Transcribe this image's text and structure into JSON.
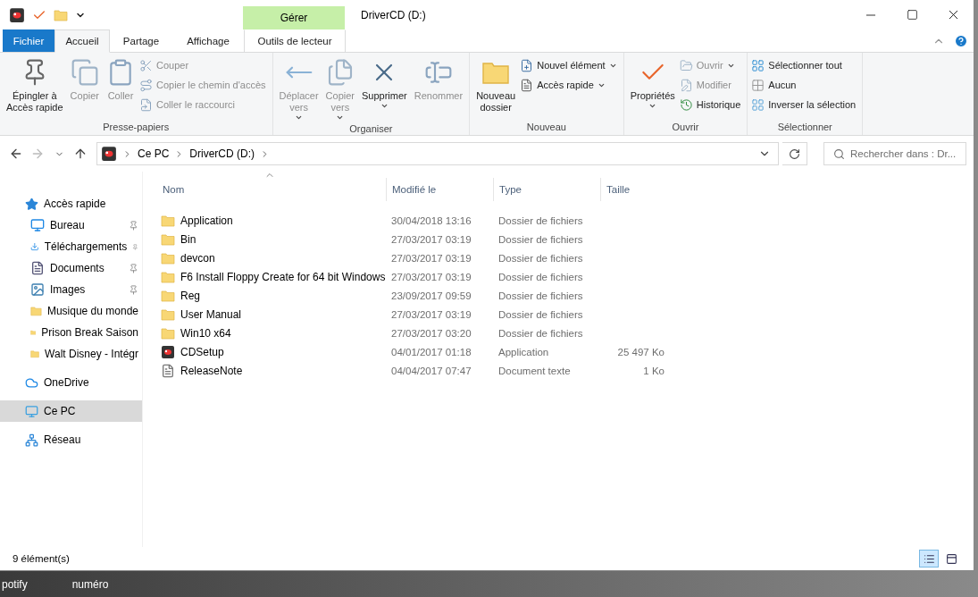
{
  "window": {
    "title": "DriverCD (D:)",
    "context_tab": "Gérer"
  },
  "ribbon_tabs": [
    {
      "label": "Fichier",
      "kind": "file",
      "selected": false
    },
    {
      "label": "Accueil",
      "kind": "tab",
      "selected": true
    },
    {
      "label": "Partage",
      "kind": "tab",
      "selected": false
    },
    {
      "label": "Affichage",
      "kind": "tab",
      "selected": false
    },
    {
      "label": "Outils de lecteur",
      "kind": "context",
      "selected": false
    }
  ],
  "ribbon_groups": [
    {
      "label": "Presse-papiers",
      "items": [
        {
          "label": "Épingler à\nAccès rapide",
          "kind": "large",
          "disabled": false,
          "dropdown": false
        },
        {
          "label": "Copier",
          "kind": "large",
          "disabled": true,
          "dropdown": false
        },
        {
          "label": "Coller",
          "kind": "large",
          "disabled": true,
          "dropdown": false
        },
        {
          "label": "Couper",
          "kind": "small",
          "disabled": true,
          "dropdown": false
        },
        {
          "label": "Copier le chemin d'accès",
          "kind": "small",
          "disabled": true,
          "dropdown": false
        },
        {
          "label": "Coller le raccourci",
          "kind": "small",
          "disabled": true,
          "dropdown": false
        }
      ]
    },
    {
      "label": "Organiser",
      "items": [
        {
          "label": "Déplacer\nvers",
          "kind": "large",
          "disabled": true,
          "dropdown": true
        },
        {
          "label": "Copier\nvers",
          "kind": "large",
          "disabled": true,
          "dropdown": true
        },
        {
          "label": "Supprimer",
          "kind": "large",
          "disabled": false,
          "dropdown": true
        },
        {
          "label": "Renommer",
          "kind": "large",
          "disabled": true,
          "dropdown": false
        }
      ]
    },
    {
      "label": "Nouveau",
      "items": [
        {
          "label": "Nouveau\ndossier",
          "kind": "large",
          "disabled": false,
          "dropdown": false
        },
        {
          "label": "Nouvel élément",
          "kind": "small",
          "disabled": false,
          "dropdown": true
        },
        {
          "label": "Accès rapide",
          "kind": "small",
          "disabled": false,
          "dropdown": true
        }
      ]
    },
    {
      "label": "Ouvrir",
      "items": [
        {
          "label": "Propriétés",
          "kind": "large",
          "disabled": false,
          "dropdown": true
        },
        {
          "label": "Ouvrir",
          "kind": "small",
          "disabled": true,
          "dropdown": true
        },
        {
          "label": "Modifier",
          "kind": "small",
          "disabled": true,
          "dropdown": false
        },
        {
          "label": "Historique",
          "kind": "small",
          "disabled": false,
          "dropdown": false
        }
      ]
    },
    {
      "label": "Sélectionner",
      "items": [
        {
          "label": "Sélectionner tout",
          "kind": "small",
          "disabled": false,
          "dropdown": false
        },
        {
          "label": "Aucun",
          "kind": "small",
          "disabled": false,
          "dropdown": false
        },
        {
          "label": "Inverser la sélection",
          "kind": "small",
          "disabled": false,
          "dropdown": false
        }
      ]
    }
  ],
  "address_bar": {
    "path": [
      "Ce PC",
      "DriverCD (D:)"
    ]
  },
  "search": {
    "placeholder": "Rechercher dans : Dr..."
  },
  "sidebar": {
    "items": [
      {
        "label": "Accès rapide",
        "selected": false,
        "children": [
          {
            "label": "Bureau",
            "pinned": true,
            "selected": false
          },
          {
            "label": "Téléchargements",
            "pinned": true,
            "selected": false
          },
          {
            "label": "Documents",
            "pinned": true,
            "selected": false
          },
          {
            "label": "Images",
            "pinned": true,
            "selected": false
          },
          {
            "label": "Musique du monde",
            "pinned": false,
            "selected": false
          },
          {
            "label": "Prison Break Saison",
            "pinned": false,
            "selected": false
          },
          {
            "label": "Walt Disney - Intégr",
            "pinned": false,
            "selected": false
          }
        ]
      },
      {
        "label": "OneDrive",
        "selected": false
      },
      {
        "label": "Ce PC",
        "selected": true
      },
      {
        "label": "Réseau",
        "selected": false
      }
    ]
  },
  "table": {
    "columns": [
      "Nom",
      "Modifié le",
      "Type",
      "Taille"
    ],
    "rows": [
      {
        "kind": "folder",
        "name": "Application",
        "modified": "30/04/2018 13:16",
        "type": "Dossier de fichiers"
      },
      {
        "kind": "folder",
        "name": "Bin",
        "modified": "27/03/2017 03:19",
        "type": "Dossier de fichiers"
      },
      {
        "kind": "folder",
        "name": "devcon",
        "modified": "27/03/2017 03:19",
        "type": "Dossier de fichiers"
      },
      {
        "kind": "folder",
        "name": "F6 Install Floppy Create for 64 bit Windows",
        "modified": "27/03/2017 03:19",
        "type": "Dossier de fichiers"
      },
      {
        "kind": "folder",
        "name": "Reg",
        "modified": "23/09/2017 09:59",
        "type": "Dossier de fichiers"
      },
      {
        "kind": "folder",
        "name": "User Manual",
        "modified": "27/03/2017 03:19",
        "type": "Dossier de fichiers"
      },
      {
        "kind": "folder",
        "name": "Win10 x64",
        "modified": "27/03/2017 03:20",
        "type": "Dossier de fichiers"
      },
      {
        "kind": "app",
        "name": "CDSetup",
        "modified": "04/01/2017 01:18",
        "type": "Application",
        "size": "25 497 Ko"
      },
      {
        "kind": "text",
        "name": "ReleaseNote",
        "modified": "04/04/2017 07:47",
        "type": "Document texte",
        "size": "1 Ko"
      }
    ]
  },
  "status_bar": {
    "count": "9 élément(s)",
    "views": [
      {
        "kind": "details",
        "selected": true
      },
      {
        "kind": "tiles",
        "selected": false
      }
    ]
  },
  "desktop": {
    "icons": [
      "potify",
      "numéro"
    ]
  }
}
